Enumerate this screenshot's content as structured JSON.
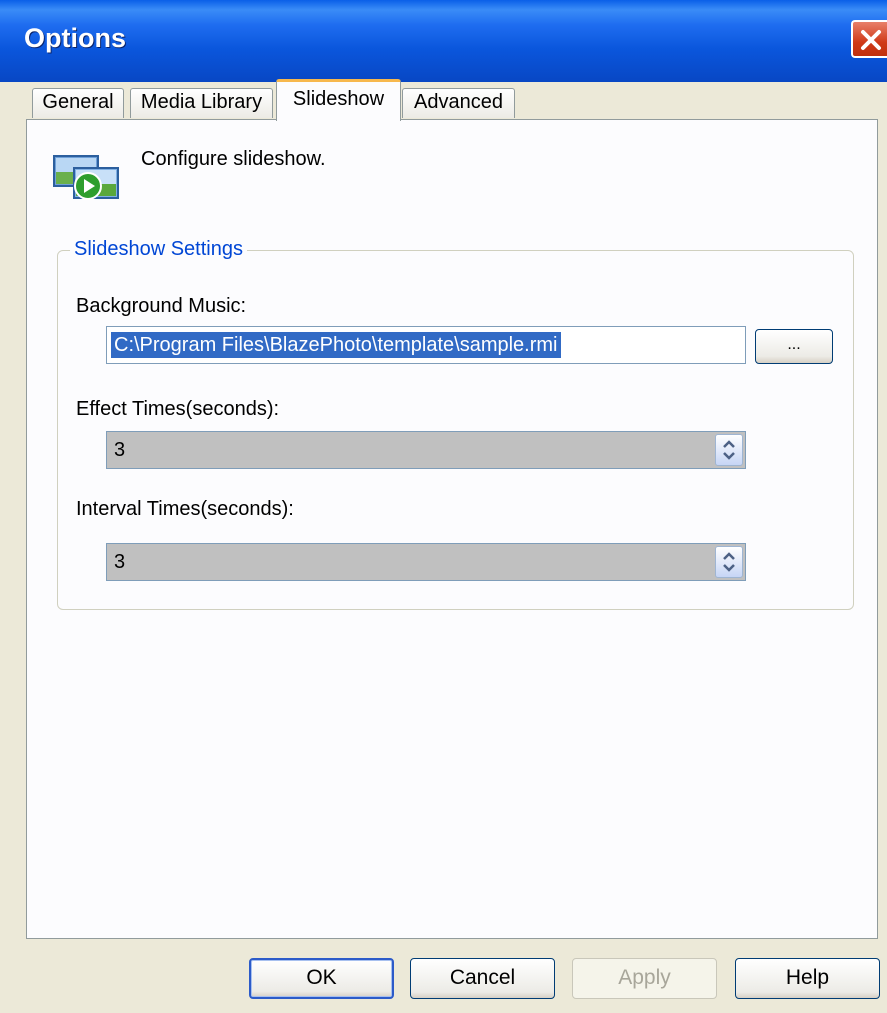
{
  "window": {
    "title": "Options"
  },
  "tabs": [
    {
      "label": "General",
      "active": false
    },
    {
      "label": "Media Library",
      "active": false
    },
    {
      "label": "Slideshow",
      "active": true
    },
    {
      "label": "Advanced",
      "active": false
    }
  ],
  "header": {
    "description": "Configure slideshow.",
    "icon": "slideshow-icon"
  },
  "group": {
    "title": "Slideshow Settings",
    "background_music": {
      "label": "Background Music:",
      "value": "C:\\Program Files\\BlazePhoto\\template\\sample.rmi",
      "browse_label": "..."
    },
    "effect_times": {
      "label": "Effect Times(seconds):",
      "value": "3"
    },
    "interval_times": {
      "label": "Interval Times(seconds):",
      "value": "3"
    }
  },
  "buttons": {
    "ok": "OK",
    "cancel": "Cancel",
    "apply": "Apply",
    "help": "Help"
  },
  "colors": {
    "titlebar": "#0a56dc",
    "accent_tab": "#f7b84d",
    "group_title": "#0046d5",
    "selection": "#316ac5"
  }
}
